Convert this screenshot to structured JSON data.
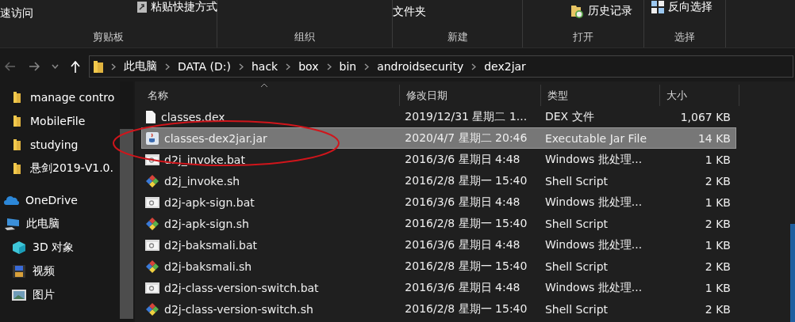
{
  "ribbon": {
    "groups": [
      {
        "label": "剪贴板",
        "items": [
          {
            "kind": "text",
            "label": "速访问"
          },
          {
            "kind": "shortcut",
            "label": "粘贴快捷方式"
          }
        ]
      },
      {
        "label": "组织"
      },
      {
        "label": "新建",
        "items": [
          {
            "kind": "text",
            "label": "文件夹"
          }
        ]
      },
      {
        "label": "打开",
        "items": [
          {
            "kind": "history",
            "label": "历史记录"
          }
        ]
      },
      {
        "label": "选择",
        "items": [
          {
            "kind": "invert",
            "label": "反向选择"
          }
        ]
      }
    ]
  },
  "address_bar": {
    "path": [
      "此电脑",
      "DATA (D:)",
      "hack",
      "box",
      "bin",
      "androidsecurity",
      "dex2jar"
    ]
  },
  "sidebar": {
    "items": [
      {
        "kind": "folder",
        "label": "manage contro"
      },
      {
        "kind": "folder",
        "label": "MobileFile"
      },
      {
        "kind": "folder",
        "label": "studying"
      },
      {
        "kind": "folder",
        "label": "悬剑2019-V1.0."
      },
      {
        "kind": "cloud",
        "label": "OneDrive"
      },
      {
        "kind": "pc",
        "label": "此电脑",
        "children": [
          {
            "kind": "cube",
            "label": "3D 对象"
          },
          {
            "kind": "video",
            "label": "视频"
          },
          {
            "kind": "image",
            "label": "图片"
          }
        ]
      }
    ]
  },
  "table": {
    "columns": [
      "名称",
      "修改日期",
      "类型",
      "大小"
    ],
    "rows": [
      {
        "kind": "file",
        "name": "classes.dex",
        "date": "2019/12/31 星期二 1...",
        "type": "DEX 文件",
        "size": "1,067 KB",
        "selected": false
      },
      {
        "kind": "jar",
        "name": "classes-dex2jar.jar",
        "date": "2020/4/7 星期二 20:46",
        "type": "Executable Jar File",
        "size": "14 KB",
        "selected": true
      },
      {
        "kind": "bat",
        "name": "d2j_invoke.bat",
        "date": "2016/3/6 星期日 4:48",
        "type": "Windows 批处理...",
        "size": "1 KB",
        "selected": false
      },
      {
        "kind": "sh",
        "name": "d2j_invoke.sh",
        "date": "2016/2/8 星期一 15:40",
        "type": "Shell Script",
        "size": "2 KB",
        "selected": false
      },
      {
        "kind": "bat",
        "name": "d2j-apk-sign.bat",
        "date": "2016/3/6 星期日 4:48",
        "type": "Windows 批处理...",
        "size": "1 KB",
        "selected": false
      },
      {
        "kind": "sh",
        "name": "d2j-apk-sign.sh",
        "date": "2016/2/8 星期一 15:40",
        "type": "Shell Script",
        "size": "2 KB",
        "selected": false
      },
      {
        "kind": "bat",
        "name": "d2j-baksmali.bat",
        "date": "2016/3/6 星期日 4:48",
        "type": "Windows 批处理...",
        "size": "1 KB",
        "selected": false
      },
      {
        "kind": "sh",
        "name": "d2j-baksmali.sh",
        "date": "2016/2/8 星期一 15:40",
        "type": "Shell Script",
        "size": "2 KB",
        "selected": false
      },
      {
        "kind": "bat",
        "name": "d2j-class-version-switch.bat",
        "date": "2016/3/6 星期日 4:48",
        "type": "Windows 批处理...",
        "size": "1 KB",
        "selected": false
      },
      {
        "kind": "sh",
        "name": "d2j-class-version-switch.sh",
        "date": "2016/2/8 星期一 15:40",
        "type": "Shell Script",
        "size": "2 KB",
        "selected": false
      }
    ]
  }
}
